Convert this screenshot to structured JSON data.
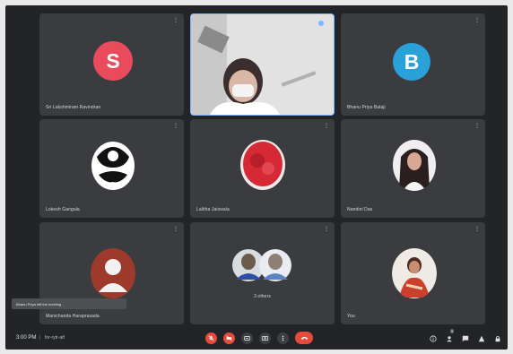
{
  "participants": [
    {
      "name": "Sri Lakshmiram Ravindran",
      "avatar": "S",
      "avatar_color": "#ea4b5c"
    },
    {
      "name": "",
      "avatar": "video",
      "avatar_color": "#bcbcbc"
    },
    {
      "name": "Bhanu Priya Balaji",
      "avatar": "B",
      "avatar_color": "#2aa1d8"
    },
    {
      "name": "Lokesh Gangula",
      "avatar": "photo",
      "avatar_color": "#ffffff"
    },
    {
      "name": "Lalitha Jaiswala",
      "avatar": "photo",
      "avatar_color": "#d52a35"
    },
    {
      "name": "Nandini Das",
      "avatar": "photo",
      "avatar_color": "#f0eef0"
    },
    {
      "name": "Manichanda Haraprasada",
      "avatar": "photo",
      "avatar_color": "#c9402e"
    },
    {
      "name": "3 others",
      "avatar": "group",
      "avatar_color": "#d8dbe0"
    },
    {
      "name": "You",
      "avatar": "photo",
      "avatar_color": "#efeae4"
    }
  ],
  "toast": {
    "text": "Bhanu Priya left the meeting"
  },
  "bottom_bar": {
    "time": "3:00 PM",
    "separator": "|",
    "meeting_code": "for-rytr-atf"
  },
  "controls": {
    "colors": {
      "mic": "#e64a3b",
      "camera": "#e64a3b",
      "neutral": "#3c4043",
      "leave": "#e64a3b"
    },
    "icons": [
      "mic-off-icon",
      "camera-off-icon",
      "captions-icon",
      "present-icon",
      "more-options-icon",
      "leave-call-icon"
    ]
  },
  "right_controls": {
    "icons": [
      "info-icon",
      "people-icon",
      "chat-icon",
      "activities-icon",
      "lock-icon"
    ],
    "participant_count": "9"
  }
}
